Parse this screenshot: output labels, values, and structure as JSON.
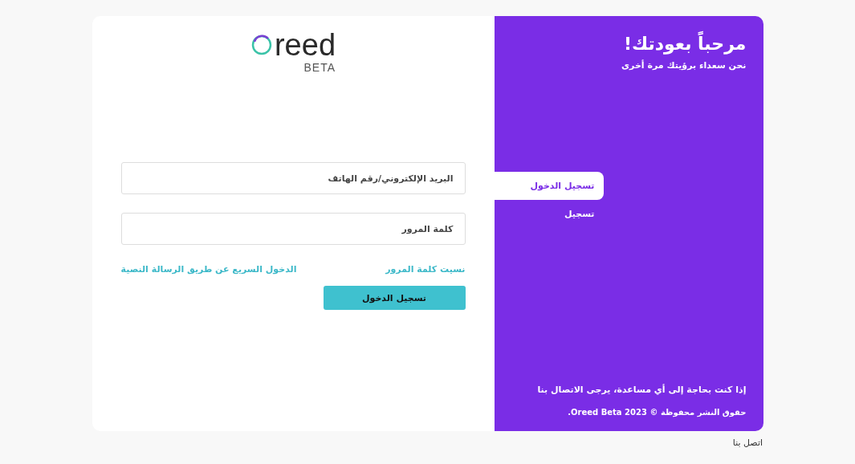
{
  "logo": {
    "wordmark": "reed",
    "tag": "BETA"
  },
  "form": {
    "fields": [
      {
        "placeholder": "البريد الإلكتروني/رقم الهاتف"
      },
      {
        "placeholder": "كلمة المرور"
      }
    ],
    "links": [
      "نسيت كلمة المرور",
      "الدخول السريع عن طريق الرسالة النصية"
    ],
    "submit": "تسجيل الدخول"
  },
  "welcome": {
    "title": "مرحباً بعودتك!",
    "subtitle": "نحن سعداء برؤيتك مرة أخرى"
  },
  "tabs": [
    {
      "label": "تسجيل الدخول",
      "selected": true
    },
    {
      "label": "تسجيل",
      "selected": false
    }
  ],
  "help": "إذا كنت بحاجة إلى أي مساعدة، يرجى الاتصال بنا",
  "copyright": "حقوق النشر محفوظة © 2023 Oreed Beta.",
  "footer_link": "اتصل بنا"
}
